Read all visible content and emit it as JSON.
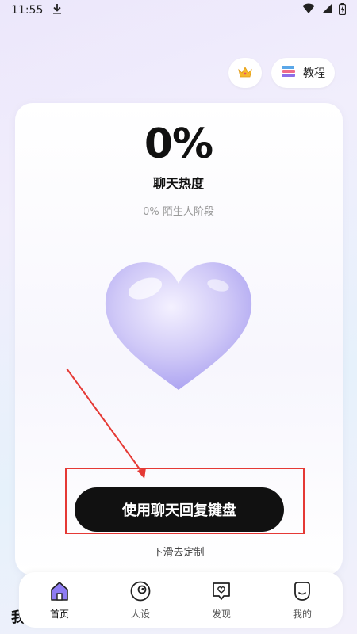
{
  "status_bar": {
    "time": "11:55",
    "download_icon": "download-icon",
    "wifi_icon": "wifi-icon",
    "signal_icon": "signal-icon",
    "battery_icon": "battery-icon"
  },
  "top_actions": {
    "crown_icon": "crown-icon",
    "tutorial_icon": "books-icon",
    "tutorial_label": "教程"
  },
  "card": {
    "percent": "0%",
    "heat_label": "聊天热度",
    "stage_label": "0% 陌生人阶段",
    "heart_icon": "heart-icon"
  },
  "cta": {
    "label": "使用聊天回复键盘"
  },
  "swipe_hint": "下滑去定制",
  "partial": {
    "text": "我",
    "chevron": "›"
  },
  "tabs": [
    {
      "label": "首页",
      "icon": "home-icon",
      "active": true
    },
    {
      "label": "人设",
      "icon": "persona-icon",
      "active": false
    },
    {
      "label": "发现",
      "icon": "discover-icon",
      "active": false
    },
    {
      "label": "我的",
      "icon": "profile-icon",
      "active": false
    }
  ],
  "colors": {
    "accent_purple": "#7b6ff0",
    "annotation_red": "#e53935",
    "button_black": "#111111"
  }
}
